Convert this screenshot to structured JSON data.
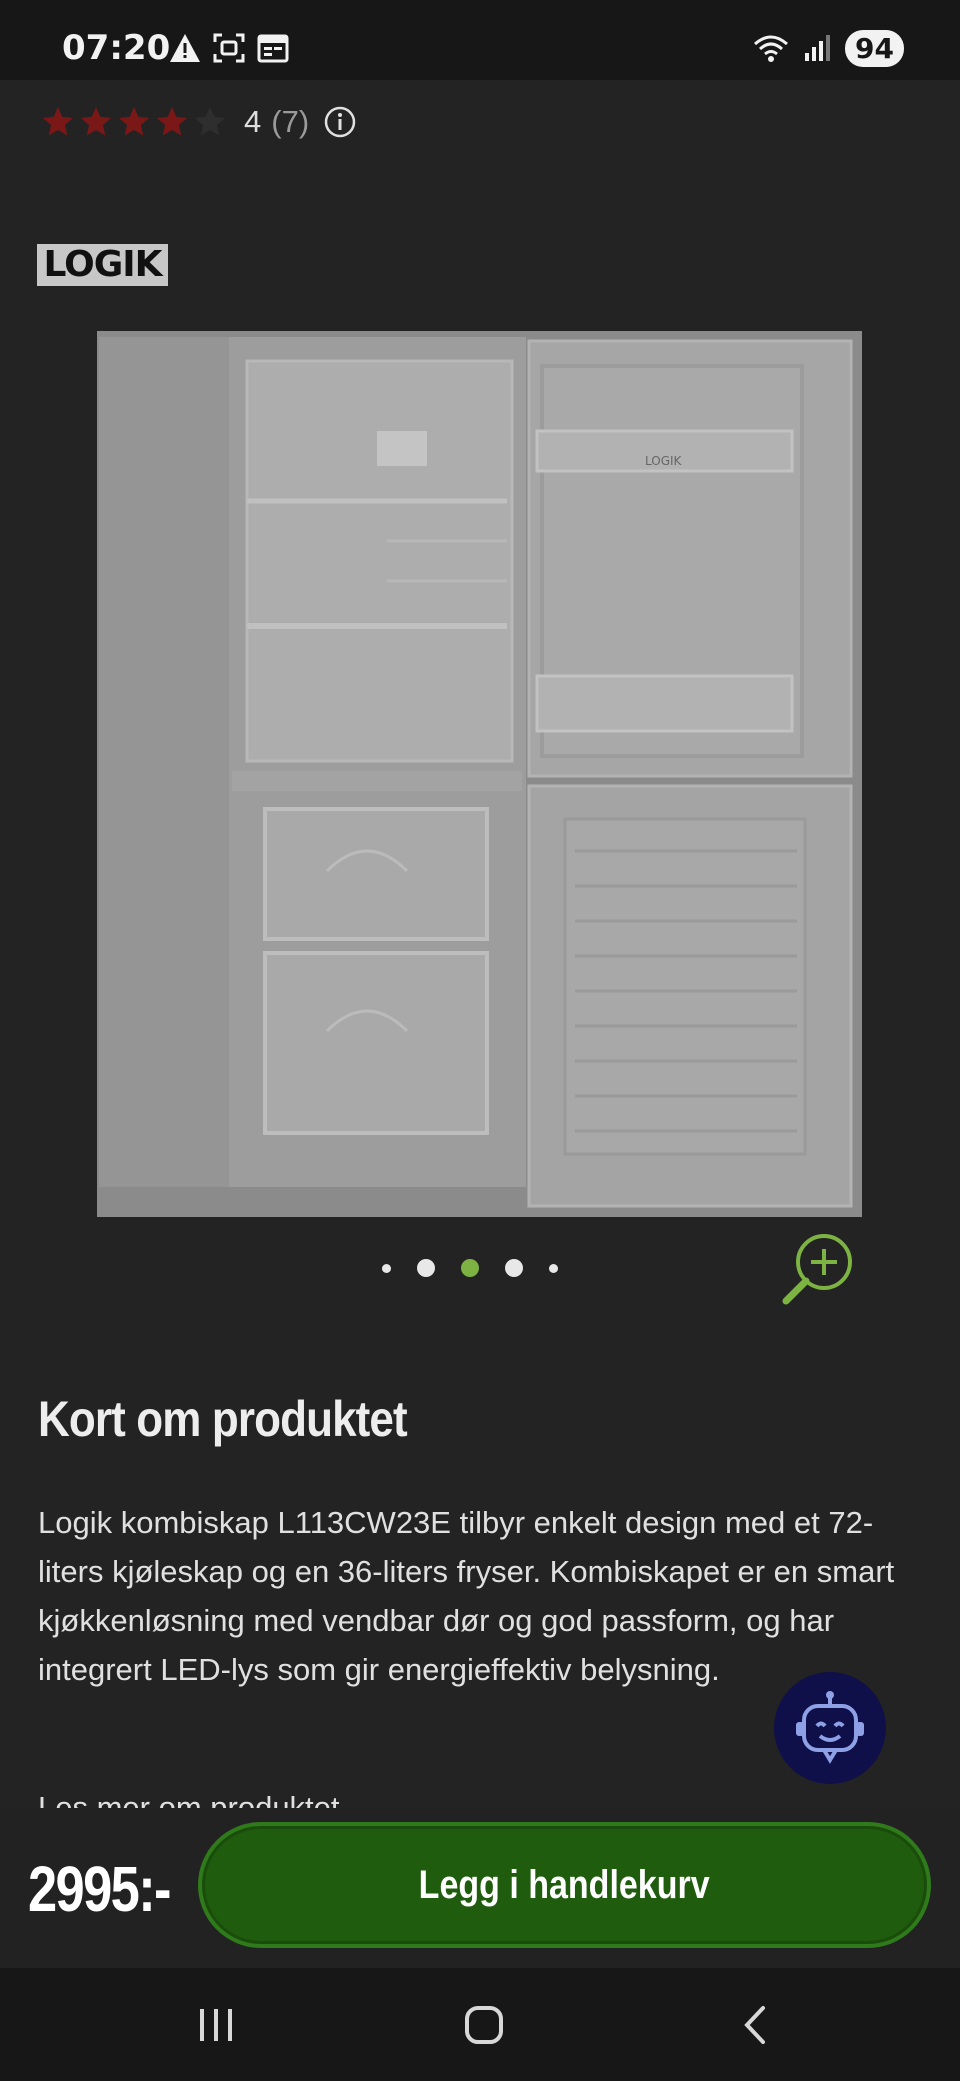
{
  "status_bar": {
    "time": "07:20",
    "battery": "94",
    "icons_left": [
      "warning-icon",
      "screenshot-icon",
      "calendar-icon"
    ],
    "icons_right": [
      "wifi-icon",
      "signal-icon"
    ]
  },
  "rating": {
    "stars_filled": 4,
    "stars_total": 5,
    "score": "4",
    "count": "(7)",
    "star_color": "#8b1a1a"
  },
  "brand": {
    "logo_text": "LOGIK"
  },
  "gallery": {
    "image_icon": "fridge-freezer-image",
    "dots_total": 5,
    "active_dot": 3,
    "active_color": "#7cb342",
    "fridge_label": "LOGIK"
  },
  "description": {
    "title": "Kort om produktet",
    "body": "Logik kombiskap L113CW23E tilbyr enkelt design med et 72-liters kjøleskap og en 36-liters fryser. Kombiskapet er en smart kjøkkenløsning med vendbar dør og god passform, og har integrert LED-lys som gir energieffektiv belysning.",
    "read_more": "Les mer om produktet"
  },
  "buy_bar": {
    "price": "2995:-",
    "cart_button": "Legg i handlekurv",
    "button_color": "#1f5c0e"
  },
  "nav_bar": {
    "icons": [
      "recent-apps-icon",
      "home-icon",
      "back-icon"
    ]
  }
}
